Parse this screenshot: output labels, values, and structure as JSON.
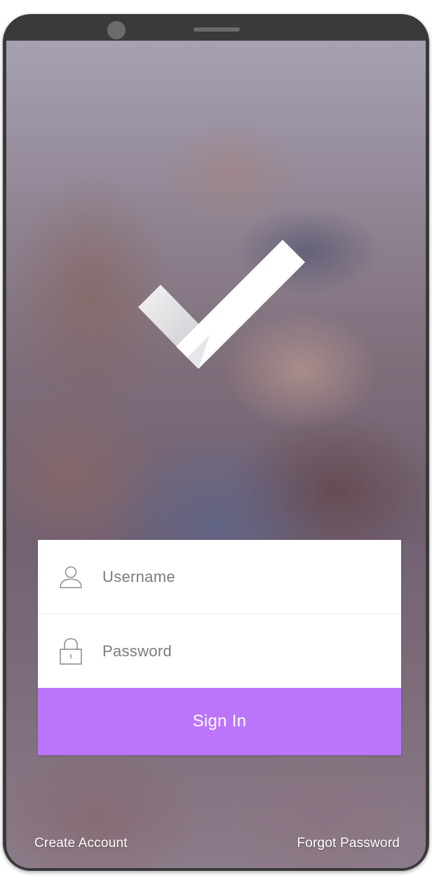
{
  "login": {
    "username_placeholder": "Username",
    "password_placeholder": "Password",
    "signin_label": "Sign In"
  },
  "footer": {
    "create_account": "Create Account",
    "forgot_password": "Forgot Password"
  },
  "colors": {
    "accent": "#bb75fb",
    "card": "#ffffff",
    "device_frame": "#3a3a3c"
  },
  "icons": {
    "logo": "checkmark-logo-icon",
    "username": "user-icon",
    "password": "lock-icon"
  }
}
